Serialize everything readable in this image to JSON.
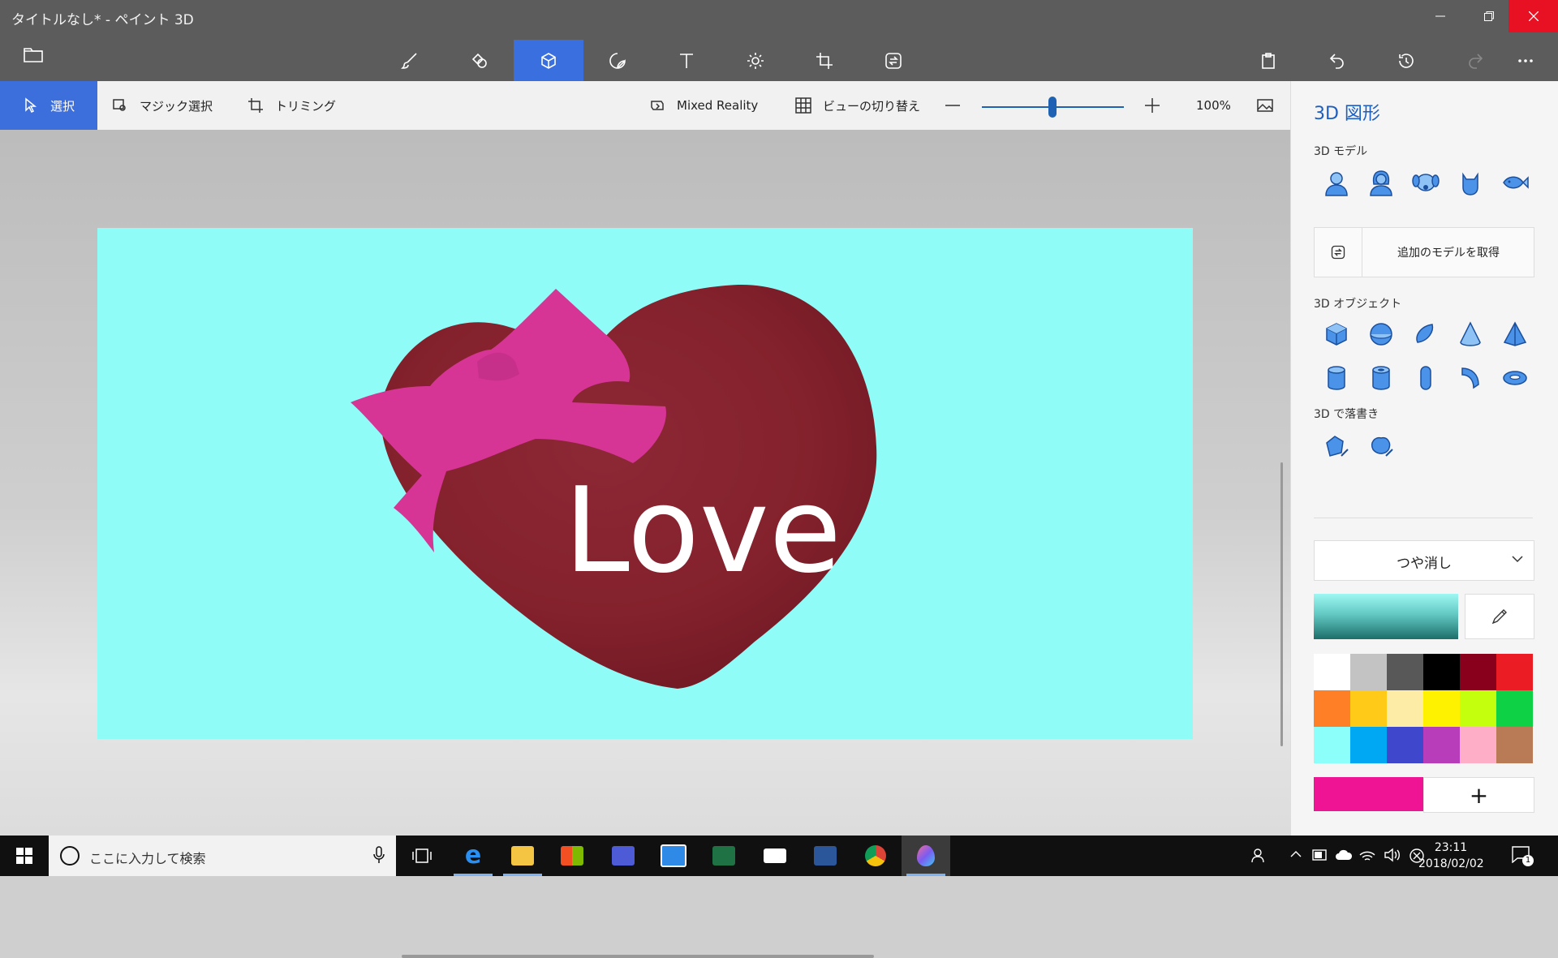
{
  "window": {
    "title": "タイトルなし* - ペイント 3D",
    "minimize_icon": "minimize-icon",
    "maximize_icon": "restore-icon",
    "close_icon": "close-icon"
  },
  "main_toolbar": {
    "tools": [
      {
        "name": "brushes",
        "icon": "brush-icon"
      },
      {
        "name": "2d-shapes",
        "icon": "2d-shapes-icon"
      },
      {
        "name": "3d-shapes",
        "icon": "cube-icon",
        "active": true
      },
      {
        "name": "stickers",
        "icon": "sticker-icon"
      },
      {
        "name": "text",
        "icon": "text-icon"
      },
      {
        "name": "effects",
        "icon": "sun-icon"
      },
      {
        "name": "canvas",
        "icon": "crop-canvas-icon"
      },
      {
        "name": "remix3d",
        "icon": "remix3d-icon"
      }
    ],
    "right_actions": [
      "paste-icon",
      "undo-icon",
      "history-icon",
      "redo-icon",
      "more-icon"
    ]
  },
  "sub_toolbar": {
    "select": "選択",
    "magic_select": "マジック選択",
    "trimming": "トリミング",
    "mixed_reality": "Mixed Reality",
    "switch_view": "ビューの切り替え",
    "zoom_percent": "100%",
    "zoom_level": 0.5
  },
  "canvas": {
    "background": "#8ffcf8",
    "text": "Love",
    "heart_color": "#8b2530",
    "bow_color": "#d63595"
  },
  "panel": {
    "title": "3D 図形",
    "models_header": "3D モデル",
    "get_more": "追加のモデルを取得",
    "objects_header": "3D オブジェクト",
    "doodle_header": "3D で落書き",
    "finish": "つや消し",
    "current_color": "#ef1493",
    "add_color_label": "+",
    "palette": [
      "#ffffff",
      "#c3c3c3",
      "#585858",
      "#000000",
      "#88001b",
      "#ec1c24",
      "#ff7f27",
      "#ffca18",
      "#fdeca6",
      "#fff200",
      "#c4ff0e",
      "#0ed145",
      "#8cfffb",
      "#00a8f3",
      "#3f48cc",
      "#b83dba",
      "#ffaec8",
      "#b97a56"
    ]
  },
  "taskbar": {
    "search_placeholder": "ここに入力して検索",
    "time": "23:11",
    "date": "2018/02/02",
    "notification_count": "1"
  }
}
